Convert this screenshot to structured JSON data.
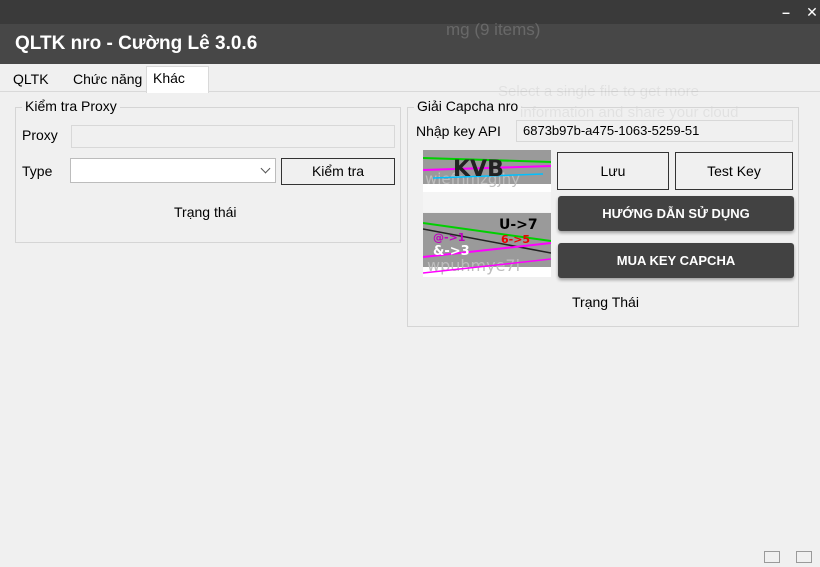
{
  "window": {
    "title": "QLTK nro - Cường Lê  3.0.6",
    "minimize_symbol": "–",
    "close_symbol": "✕",
    "ghost_text_1": "mg (9 items)",
    "ghost_text_2": "Select a single file to get more",
    "ghost_text_3": "information and share your cloud"
  },
  "tabs": [
    {
      "label": "QLTK"
    },
    {
      "label": "Chức năng"
    },
    {
      "label": "Khác",
      "active": true
    }
  ],
  "proxy_group": {
    "title": "Kiểm tra Proxy",
    "proxy_label": "Proxy",
    "proxy_value": "",
    "type_label": "Type",
    "type_value": "",
    "check_button": "Kiểm tra",
    "status": "Trạng thái"
  },
  "captcha_group": {
    "title": "Giải Capcha nro",
    "api_key_label": "Nhập key API",
    "api_key_value": "6873b97b-a475-1063-5259-51",
    "save_button": "Lưu",
    "test_key_button": "Test Key",
    "guide_button": "HƯỚNG DẪN SỬ DỤNG",
    "buy_key_button": "MUA KEY CAPCHA",
    "status": "Trạng Thái",
    "captcha_image_1_text": "KVB",
    "captcha_image_1_bg_text": "wiefhmzgjhy",
    "captcha_image_2_text_1": "U->7",
    "captcha_image_2_text_2": "&->3",
    "captcha_image_2_text_3": "6->5",
    "captcha_image_2_text_4": "@->1",
    "captcha_image_2_bg_text": "wpuhmye7l"
  },
  "colors": {
    "title_bar": "#474747",
    "dark_button": "#424242",
    "background": "#f0f0f0"
  }
}
